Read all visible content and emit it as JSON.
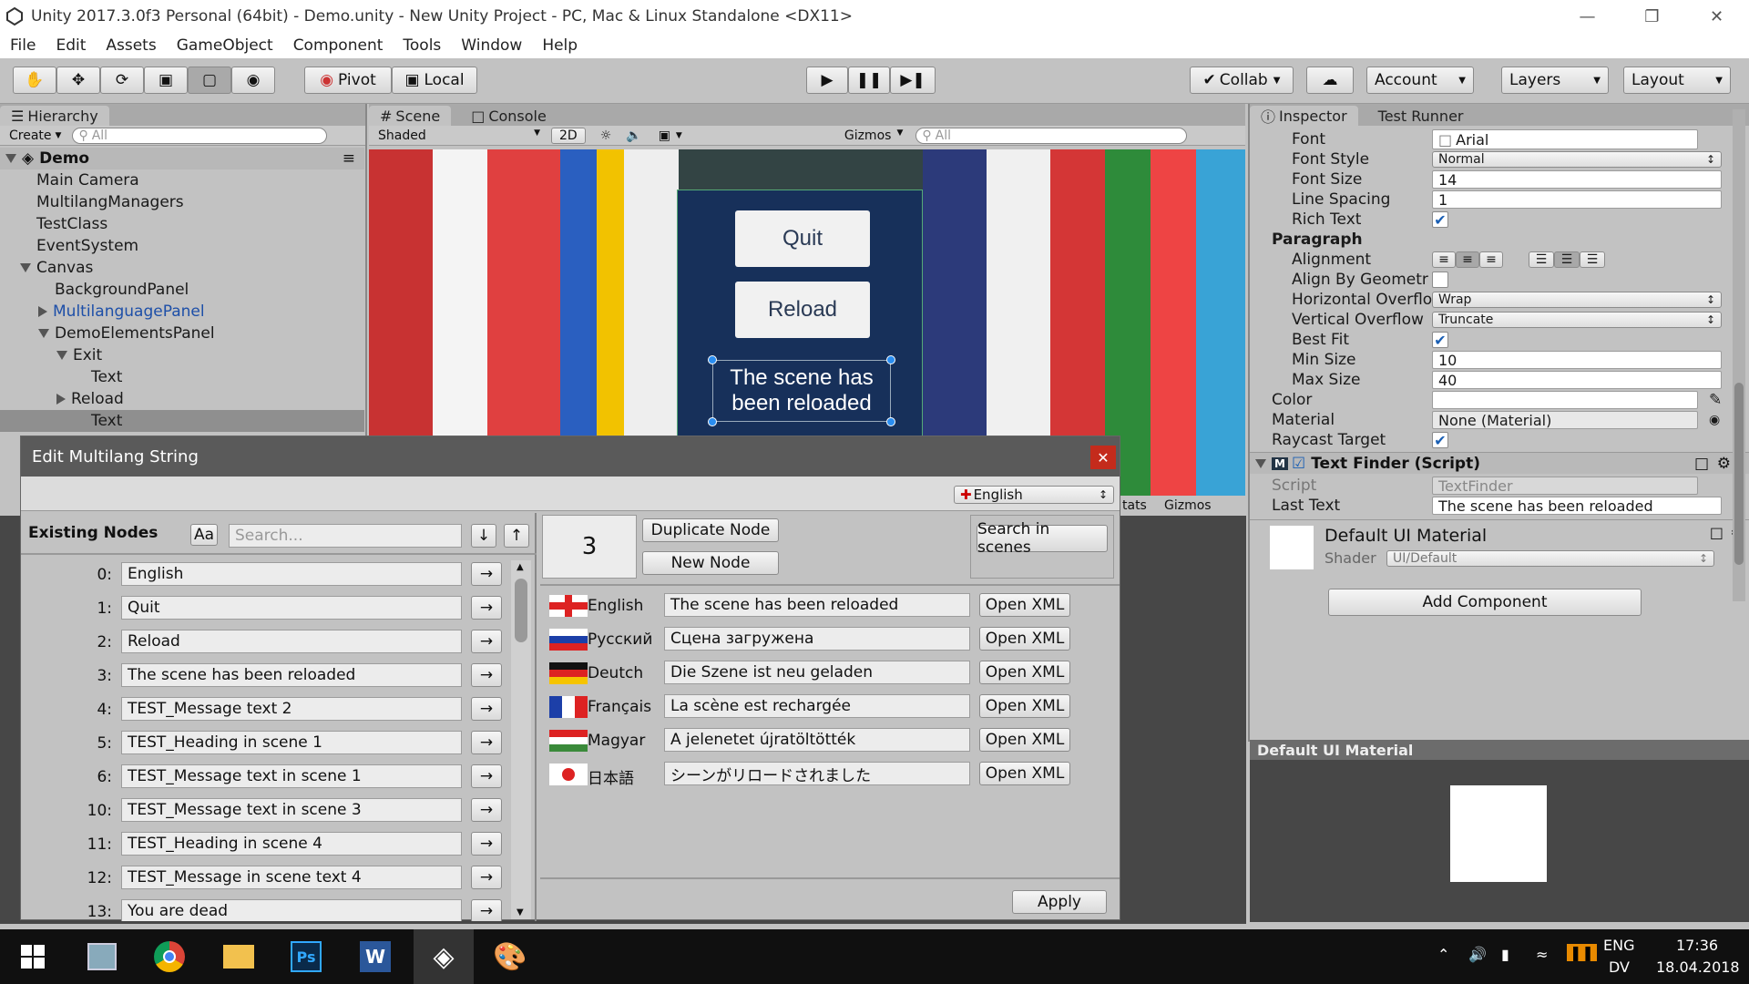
{
  "window": {
    "title": "Unity 2017.3.0f3 Personal (64bit) - Demo.unity - New Unity Project - PC, Mac & Linux Standalone <DX11>"
  },
  "menu": [
    "File",
    "Edit",
    "Assets",
    "GameObject",
    "Component",
    "Tools",
    "Window",
    "Help"
  ],
  "toolbar": {
    "pivot": "Pivot",
    "local": "Local",
    "collab": "Collab",
    "account": "Account",
    "layers": "Layers",
    "layout": "Layout"
  },
  "hierarchy": {
    "tab": "Hierarchy",
    "create": "Create",
    "search_placeholder": "All",
    "scene": "Demo",
    "items": [
      {
        "label": "Main Camera",
        "indent": 1
      },
      {
        "label": "MultilangManagers",
        "indent": 1
      },
      {
        "label": "TestClass",
        "indent": 1
      },
      {
        "label": "EventSystem",
        "indent": 1
      },
      {
        "label": "Canvas",
        "indent": 1
      },
      {
        "label": "BackgroundPanel",
        "indent": 2
      },
      {
        "label": "MultilanguagePanel",
        "indent": 2
      },
      {
        "label": "DemoElementsPanel",
        "indent": 2
      },
      {
        "label": "Exit",
        "indent": 3
      },
      {
        "label": "Text",
        "indent": 4
      },
      {
        "label": "Reload",
        "indent": 3
      },
      {
        "label": "Text",
        "indent": 4
      }
    ]
  },
  "scene": {
    "tab_scene": "Scene",
    "tab_console": "Console",
    "shading": "Shaded",
    "mode2d": "2D",
    "gizmos": "Gizmos",
    "search_placeholder": "All",
    "quit_label": "Quit",
    "reload_label": "Reload",
    "message": "The scene has been reloaded"
  },
  "bottom": {
    "stats": "tats",
    "gizmos": "Gizmos"
  },
  "inspector": {
    "tab": "Inspector",
    "tab2": "Test Runner",
    "font_label": "Font",
    "font": "Arial",
    "font_style_label": "Font Style",
    "font_style": "Normal",
    "font_size_label": "Font Size",
    "font_size": "14",
    "line_spacing_label": "Line Spacing",
    "line_spacing": "1",
    "rich_text_label": "Rich Text",
    "paragraph": "Paragraph",
    "alignment_label": "Alignment",
    "align_geom_label": "Align By Geometr",
    "h_overflow_label": "Horizontal Overflo",
    "h_overflow": "Wrap",
    "v_overflow_label": "Vertical Overflow",
    "v_overflow": "Truncate",
    "best_fit_label": "Best Fit",
    "min_size_label": "Min Size",
    "min_size": "10",
    "max_size_label": "Max Size",
    "max_size": "40",
    "color_label": "Color",
    "material_label": "Material",
    "material": "None (Material)",
    "raycast_label": "Raycast Target",
    "component": "Text Finder (Script)",
    "script_label": "Script",
    "script": "TextFinder",
    "last_text_label": "Last Text",
    "last_text": "The scene has been reloaded",
    "default_mat": "Default UI Material",
    "shader_label": "Shader",
    "shader": "UI/Default",
    "add_component": "Add Component",
    "preview_title": "Default UI Material"
  },
  "dialog": {
    "title": "Edit Multilang String",
    "language": "English",
    "existing_nodes": "Existing Nodes",
    "case_btn": "Aa",
    "search_placeholder": "Search...",
    "node_id": "3",
    "duplicate": "Duplicate Node",
    "new_node": "New Node",
    "search_scenes": "Search in scenes",
    "apply": "Apply",
    "open_xml": "Open XML",
    "nodes": [
      {
        "idx": "0:",
        "text": "English"
      },
      {
        "idx": "1:",
        "text": "Quit"
      },
      {
        "idx": "2:",
        "text": "Reload"
      },
      {
        "idx": "3:",
        "text": "The scene has been reloaded"
      },
      {
        "idx": "4:",
        "text": "TEST_Message text 2"
      },
      {
        "idx": "5:",
        "text": "TEST_Heading in scene 1"
      },
      {
        "idx": "6:",
        "text": "TEST_Message text in scene 1"
      },
      {
        "idx": "10:",
        "text": "TEST_Message text in scene 3"
      },
      {
        "idx": "11:",
        "text": "TEST_Heading in scene 4"
      },
      {
        "idx": "12:",
        "text": "TEST_Message in scene text 4"
      },
      {
        "idx": "13:",
        "text": "You are dead"
      }
    ],
    "translations": [
      {
        "lang": "English",
        "text": "The scene has been reloaded",
        "flag": "gb"
      },
      {
        "lang": "Русский",
        "text": "Сцена загружена",
        "flag": "ru"
      },
      {
        "lang": "Deutch",
        "text": "Die Szene ist neu geladen",
        "flag": "de"
      },
      {
        "lang": "Français",
        "text": "La scène est rechargée",
        "flag": "fr"
      },
      {
        "lang": "Magyar",
        "text": "A jelenetet újratöltötték",
        "flag": "hu"
      },
      {
        "lang": "日本語",
        "text": "シーンがリロードされました",
        "flag": "jp"
      }
    ]
  },
  "taskbar": {
    "lang1": "ENG",
    "lang2": "DV",
    "time": "17:36",
    "date": "18.04.2018"
  }
}
